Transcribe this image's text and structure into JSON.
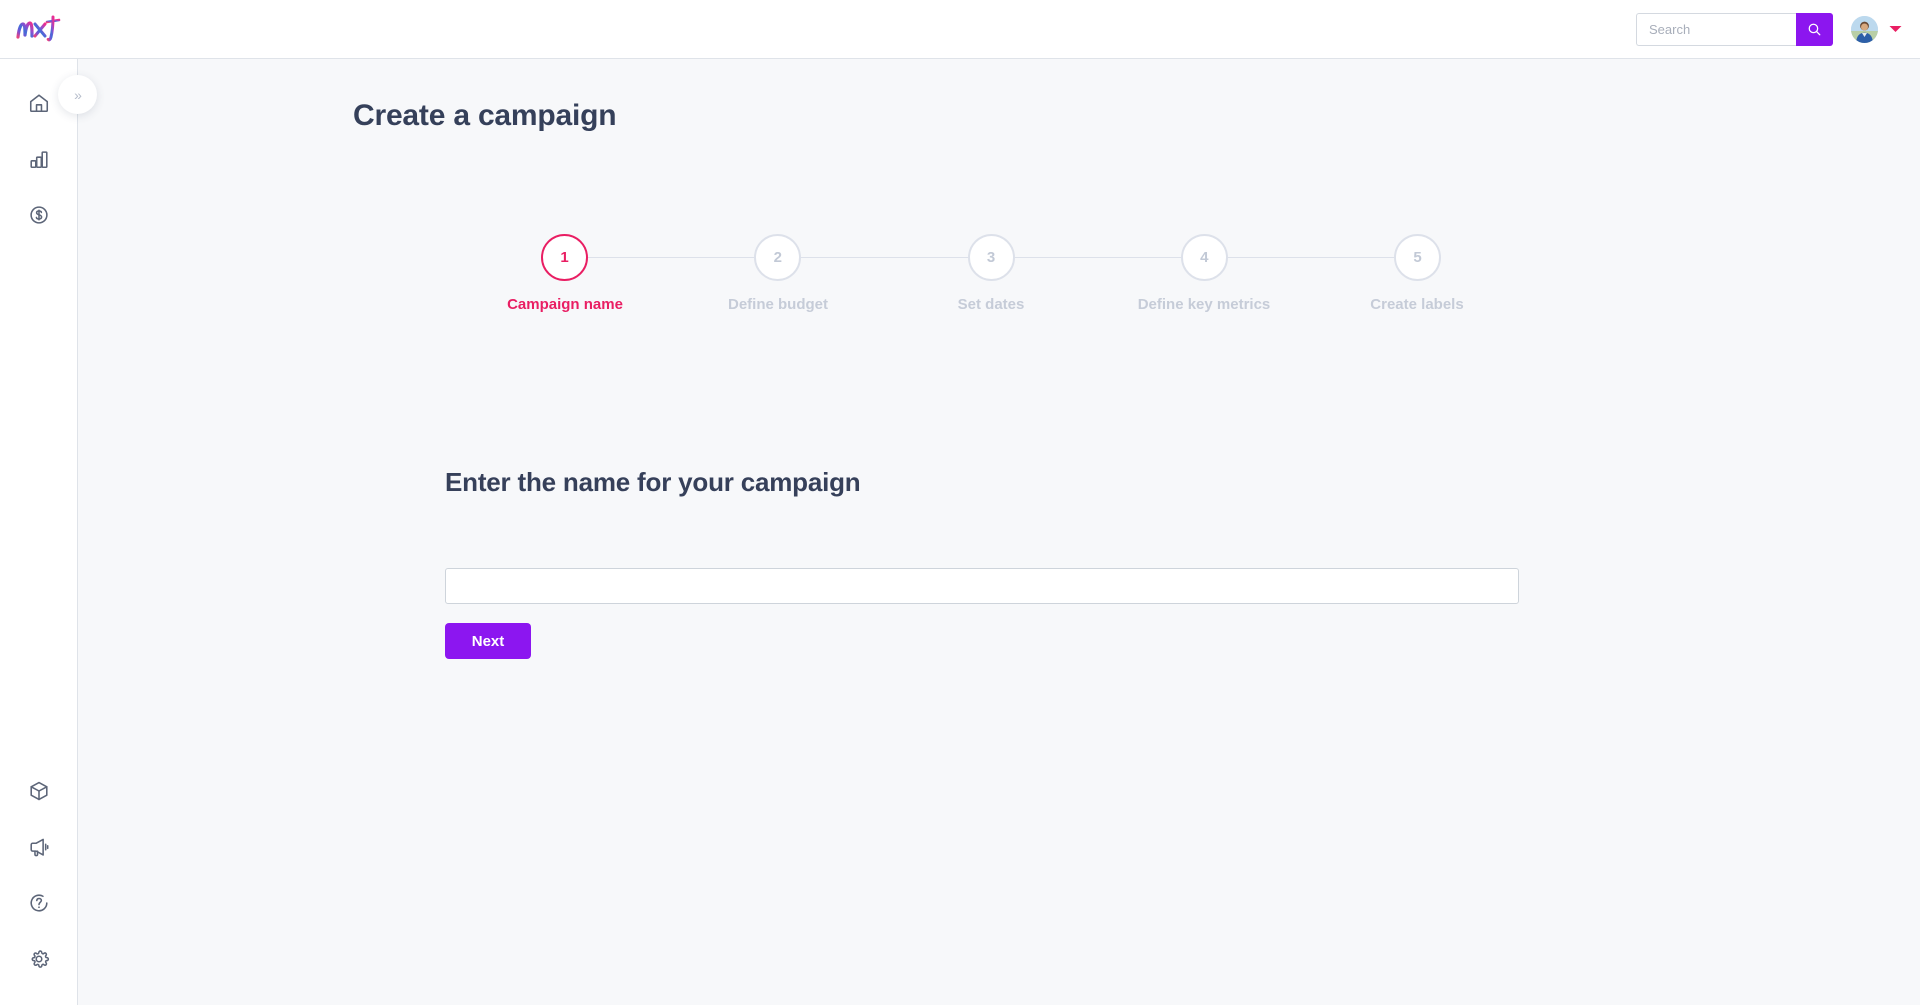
{
  "app": {
    "logo_text": "nxt"
  },
  "header": {
    "search": {
      "placeholder": "Search",
      "value": "",
      "icon": "search-icon",
      "button_color": "#8c16ef"
    },
    "avatar_icon": "user-avatar",
    "caret_icon": "chevron-down-icon",
    "caret_color": "#e91e63"
  },
  "sidebar": {
    "collapse_toggle_label": "»",
    "top_items": [
      {
        "icon": "home-icon",
        "name": "sidebar-item-home"
      },
      {
        "icon": "bar-chart-icon",
        "name": "sidebar-item-analytics"
      },
      {
        "icon": "dollar-circle-icon",
        "name": "sidebar-item-billing"
      }
    ],
    "bottom_items": [
      {
        "icon": "box-icon",
        "name": "sidebar-item-products"
      },
      {
        "icon": "megaphone-icon",
        "name": "sidebar-item-campaigns"
      },
      {
        "icon": "help-circle-icon",
        "name": "sidebar-item-help"
      },
      {
        "icon": "gear-icon",
        "name": "sidebar-item-settings"
      }
    ]
  },
  "main": {
    "page_title": "Create a campaign",
    "stepper": {
      "active_index": 0,
      "active_color": "#e91e63",
      "inactive_color": "#c6ccd8",
      "steps": [
        {
          "number": "1",
          "label": "Campaign name"
        },
        {
          "number": "2",
          "label": "Define budget"
        },
        {
          "number": "3",
          "label": "Set dates"
        },
        {
          "number": "4",
          "label": "Define key metrics"
        },
        {
          "number": "5",
          "label": "Create labels"
        }
      ]
    },
    "form": {
      "heading": "Enter the name for your campaign",
      "campaign_name_value": "",
      "campaign_name_placeholder": "",
      "next_label": "Next",
      "next_color": "#8c16f0"
    }
  }
}
